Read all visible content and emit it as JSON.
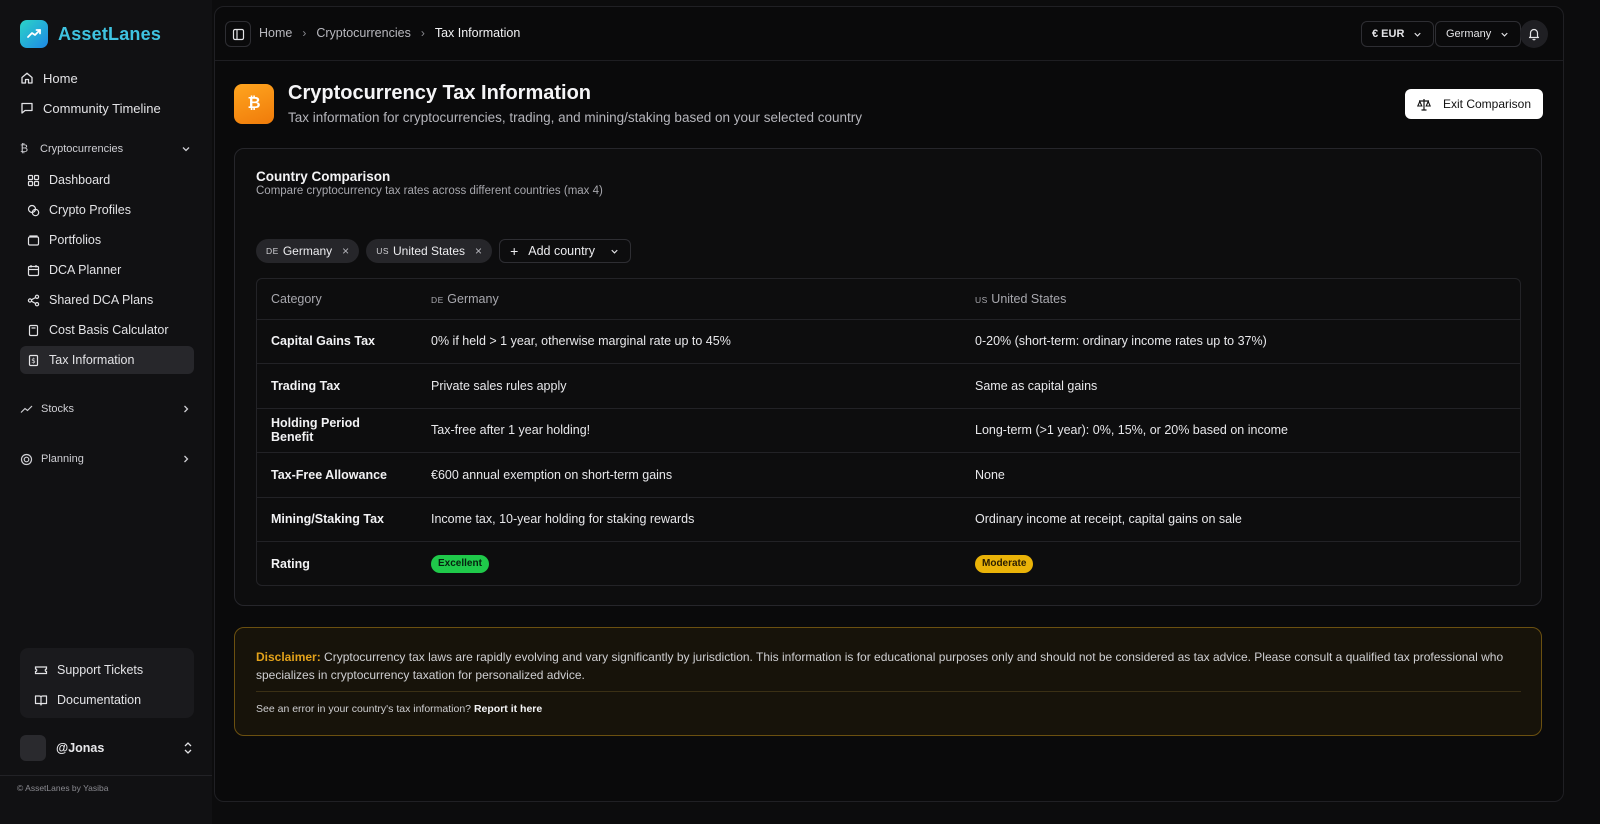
{
  "brand": {
    "name": "AssetLanes"
  },
  "sidebar": {
    "top_items": [
      {
        "label": "Home",
        "icon": "home-icon"
      },
      {
        "label": "Community Timeline",
        "icon": "message-square-icon"
      }
    ],
    "groups": [
      {
        "label": "Cryptocurrencies",
        "icon": "bitcoin-icon",
        "expanded": true,
        "items": [
          {
            "label": "Dashboard",
            "icon": "grid-icon"
          },
          {
            "label": "Crypto Profiles",
            "icon": "coins-icon"
          },
          {
            "label": "Portfolios",
            "icon": "wallet-icon"
          },
          {
            "label": "DCA Planner",
            "icon": "calendar-icon"
          },
          {
            "label": "Shared DCA Plans",
            "icon": "share-icon"
          },
          {
            "label": "Cost Basis Calculator",
            "icon": "calculator-icon"
          },
          {
            "label": "Tax Information",
            "icon": "receipt-icon",
            "active": true
          }
        ]
      },
      {
        "label": "Stocks",
        "icon": "trending-up-icon",
        "expanded": false
      },
      {
        "label": "Planning",
        "icon": "target-icon",
        "expanded": false
      }
    ],
    "support": [
      {
        "label": "Support Tickets",
        "icon": "ticket-icon"
      },
      {
        "label": "Documentation",
        "icon": "book-icon"
      }
    ],
    "user": {
      "name": "@Jonas"
    },
    "copyright": "© AssetLanes by Yasiba"
  },
  "topbar": {
    "breadcrumb": [
      "Home",
      "Cryptocurrencies",
      "Tax Information"
    ],
    "currency": "€ EUR",
    "country": "Germany"
  },
  "page": {
    "title": "Cryptocurrency Tax Information",
    "subtitle": "Tax information for cryptocurrencies, trading, and mining/staking based on your selected country",
    "exit_button": "Exit Comparison"
  },
  "comparison": {
    "title": "Country Comparison",
    "subtitle": "Compare cryptocurrency tax rates across different countries (max 4)",
    "chips": [
      {
        "code": "DE",
        "name": "Germany"
      },
      {
        "code": "US",
        "name": "United States"
      }
    ],
    "add_country": "Add country",
    "header": {
      "category": "Category",
      "col1_code": "DE",
      "col1": "Germany",
      "col2_code": "US",
      "col2": "United States"
    },
    "rows": [
      {
        "category": "Capital Gains Tax",
        "de": "0% if held > 1 year, otherwise marginal rate up to 45%",
        "us": "0-20% (short-term: ordinary income rates up to 37%)"
      },
      {
        "category": "Trading Tax",
        "de": "Private sales rules apply",
        "us": "Same as capital gains"
      },
      {
        "category": "Holding Period Benefit",
        "de": "Tax-free after 1 year holding!",
        "us": "Long-term (>1 year): 0%, 15%, or 20% based on income"
      },
      {
        "category": "Tax-Free Allowance",
        "de": "€600 annual exemption on short-term gains",
        "us": "None"
      },
      {
        "category": "Mining/Staking Tax",
        "de": "Income tax, 10-year holding for staking rewards",
        "us": "Ordinary income at receipt, capital gains on sale"
      }
    ],
    "rating": {
      "category": "Rating",
      "de": {
        "label": "Excellent",
        "color": "#1fc94a"
      },
      "us": {
        "label": "Moderate",
        "color": "#eab308"
      }
    }
  },
  "disclaimer": {
    "label": "Disclaimer:",
    "text": "Cryptocurrency tax laws are rapidly evolving and vary significantly by jurisdiction. This information is for educational purposes only and should not be considered as tax advice. Please consult a qualified tax professional who specializes in cryptocurrency taxation for personalized advice.",
    "report_prefix": "See an error in your country's tax information?",
    "report_link": "Report it here"
  },
  "colors": {
    "accent": "#3fc3e0",
    "warning": "#e3a21a",
    "success": "#1fc94a",
    "moderate": "#eab308"
  }
}
